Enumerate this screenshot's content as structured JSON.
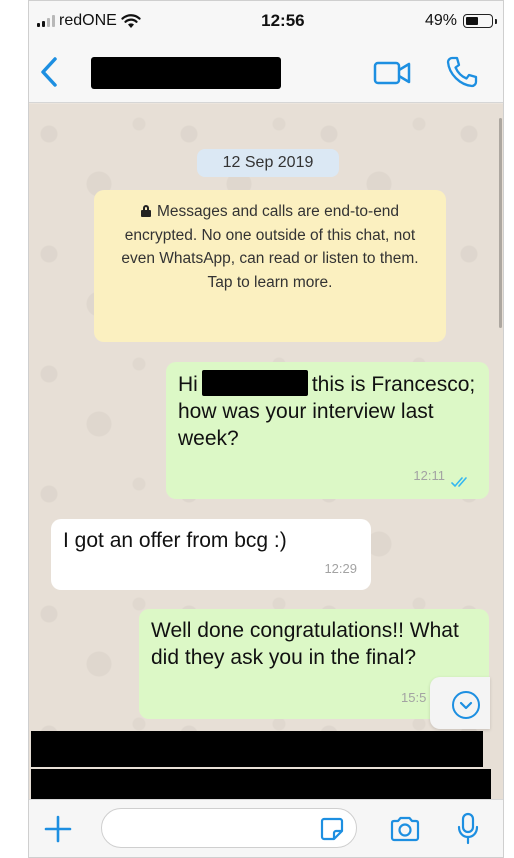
{
  "status_bar": {
    "carrier": "redONE",
    "time": "12:56",
    "battery_percent": "49%",
    "battery_level": 0.49,
    "signal_bars_active": 2,
    "signal_bars_total": 4
  },
  "header": {
    "back_icon": "chevron-left-icon",
    "contact_name": "[redacted]",
    "video_call_icon": "video-camera-icon",
    "voice_call_icon": "phone-icon"
  },
  "chat": {
    "date_label": "12 Sep 2019",
    "encryption_notice": "Messages and calls are end-to-end encrypted. No one outside of this chat, not even WhatsApp, can read or listen to them. Tap to learn more.",
    "messages": [
      {
        "direction": "outgoing",
        "text_before": "Hi",
        "text_after": "this is Francesco; how was your interview last week?",
        "time": "12:11",
        "status": "read"
      },
      {
        "direction": "incoming",
        "text": "I got an offer from bcg :)",
        "time": "12:29"
      },
      {
        "direction": "outgoing",
        "text": "Well done congratulations!! What did they ask you in the final?",
        "time": "15:5"
      }
    ],
    "scroll_down_icon": "chevron-down-circle-icon"
  },
  "input_bar": {
    "message_value": "",
    "icons": [
      "plus-icon",
      "sticker-icon",
      "camera-icon",
      "microphone-icon"
    ]
  },
  "colors": {
    "accent": "#1d8fe1",
    "outgoing_bubble": "#dcf8c6",
    "incoming_bubble": "#ffffff",
    "encryption_notice_bg": "#fbf0c0",
    "date_pill_bg": "#dbe8f4",
    "read_ticks": "#34b7f1"
  }
}
